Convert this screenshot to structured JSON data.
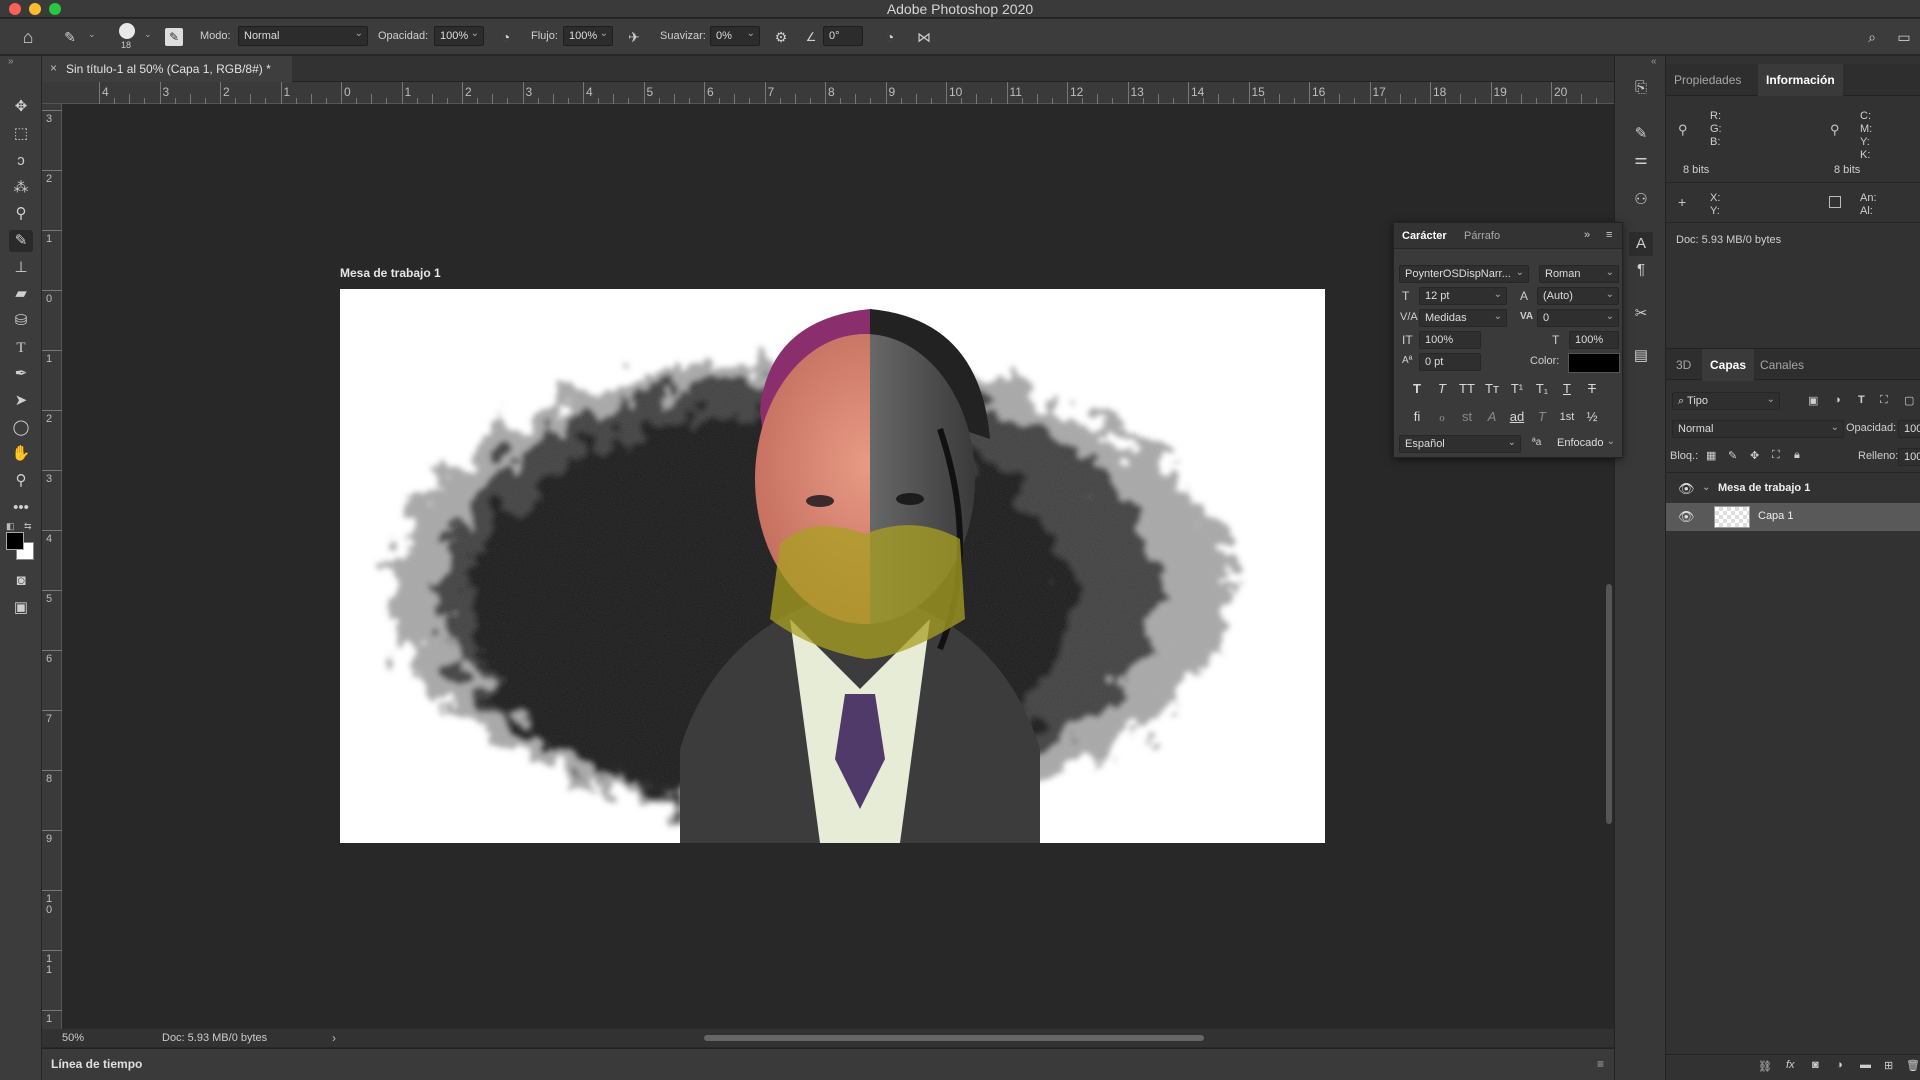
{
  "app": {
    "title": "Adobe Photoshop 2020"
  },
  "options_bar": {
    "brush_size": "18",
    "mode_label": "Modo:",
    "mode_value": "Normal",
    "opacity_label": "Opacidad:",
    "opacity_value": "100%",
    "flow_label": "Flujo:",
    "flow_value": "100%",
    "smoothing_label": "Suavizar:",
    "smoothing_value": "0%",
    "angle_value": "0°"
  },
  "document": {
    "tab_title": "Sin título-1 al 50% (Capa 1, RGB/8#) *",
    "artboard_label": "Mesa de trabajo 1"
  },
  "rulers": {
    "top": [
      "4",
      "3",
      "2",
      "1",
      "0",
      "1",
      "2",
      "3",
      "4",
      "5",
      "6",
      "7",
      "8",
      "9",
      "10",
      "11",
      "12",
      "13",
      "14",
      "15",
      "16",
      "17",
      "18",
      "19",
      "20"
    ],
    "left": [
      "3",
      "2",
      "1",
      "0",
      "1",
      "2",
      "3",
      "4",
      "5",
      "6",
      "7",
      "8",
      "9",
      "1\n0",
      "1\n1",
      "1"
    ]
  },
  "status_bar": {
    "zoom": "50%",
    "doc_info": "Doc: 5.93 MB/0 bytes",
    "arrow": "›"
  },
  "timeline": {
    "label": "Línea de tiempo"
  },
  "info_panel": {
    "tabs": [
      "Propiedades",
      "Información"
    ],
    "active_tab": "Información",
    "rgb_labels": [
      "R:",
      "G:",
      "B:"
    ],
    "cmyk_labels": [
      "C:",
      "M:",
      "Y:",
      "K:"
    ],
    "bits_left": "8 bits",
    "bits_right": "8 bits",
    "xy_labels": [
      "X:",
      "Y:"
    ],
    "size_labels": [
      "An:",
      "Al:"
    ],
    "doc_info": "Doc: 5.93 MB/0 bytes"
  },
  "character_panel": {
    "tabs": [
      "Carácter",
      "Párrafo"
    ],
    "font_family": "PoynterOSDispNarr...",
    "font_style": "Roman",
    "font_size": "12 pt",
    "leading": "(Auto)",
    "kerning": "Medidas",
    "tracking": "0",
    "vertical_scale": "100%",
    "horizontal_scale": "100%",
    "baseline_shift": "0 pt",
    "color_label": "Color:",
    "color_value": "#000000",
    "language": "Español",
    "antialias_glyph": "ªa",
    "antialias": "Enfocado",
    "type_style_glyphs": [
      "T",
      "T",
      "TT",
      "Tт",
      "T¹",
      "T₁",
      "T",
      "T"
    ],
    "opentype_glyphs": [
      "fi",
      "ℴ",
      "st",
      "A",
      "ad",
      "T",
      "1st",
      "½"
    ]
  },
  "layers_panel": {
    "tabs": [
      "3D",
      "Capas",
      "Canales"
    ],
    "active_tab": "Capas",
    "filter_value": "Tipo",
    "blend_mode": "Normal",
    "opacity_label": "Opacidad:",
    "opacity_value": "100",
    "lock_label": "Bloq.:",
    "fill_label": "Relleno:",
    "fill_value": "100",
    "layers": [
      {
        "name": "Mesa de trabajo 1",
        "type": "artboard"
      },
      {
        "name": "Capa 1",
        "type": "pixel",
        "selected": true
      }
    ]
  },
  "colors": {
    "foreground": "#000000",
    "background": "#ffffff",
    "accent": "#1473e6"
  }
}
